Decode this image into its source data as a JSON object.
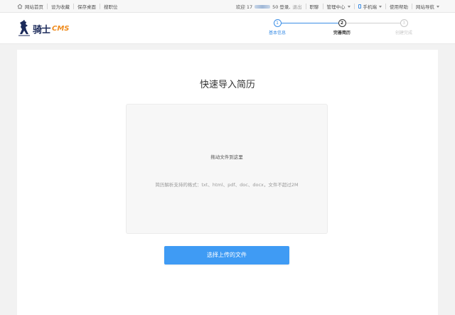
{
  "topbar": {
    "home": "网站首页",
    "bookmark": "设为收藏",
    "desktop": "保存桌面",
    "find_job": "搜职位",
    "welcome_prefix": "欢迎 17",
    "welcome_suffix": "50 登录,",
    "logout": "退出",
    "jobs": "职聊",
    "admin_center": "管理中心",
    "mobile": "手机端",
    "help": "使用帮助",
    "site_nav": "网站导航"
  },
  "header": {
    "logo_text": "骑士",
    "logo_cms": "CMS"
  },
  "steps": [
    {
      "number": "1",
      "label": "基本信息",
      "state": "done"
    },
    {
      "number": "2",
      "label": "完善简历",
      "state": "active"
    },
    {
      "number": "3",
      "label": "创建完成",
      "state": "pending"
    }
  ],
  "main": {
    "title": "快速导入简历",
    "drop_text": "拖动文件到这里",
    "format_hint": "简历解析支持的格式：txt、html、pdf、doc、docx，文件不超过2M",
    "upload_button": "选择上传的文件"
  },
  "colors": {
    "accent": "#3f9bf4",
    "step_done": "#3b8ee6",
    "step_active": "#333333",
    "step_pending": "#c8c8c8",
    "logo_orange": "#f08c1e"
  }
}
